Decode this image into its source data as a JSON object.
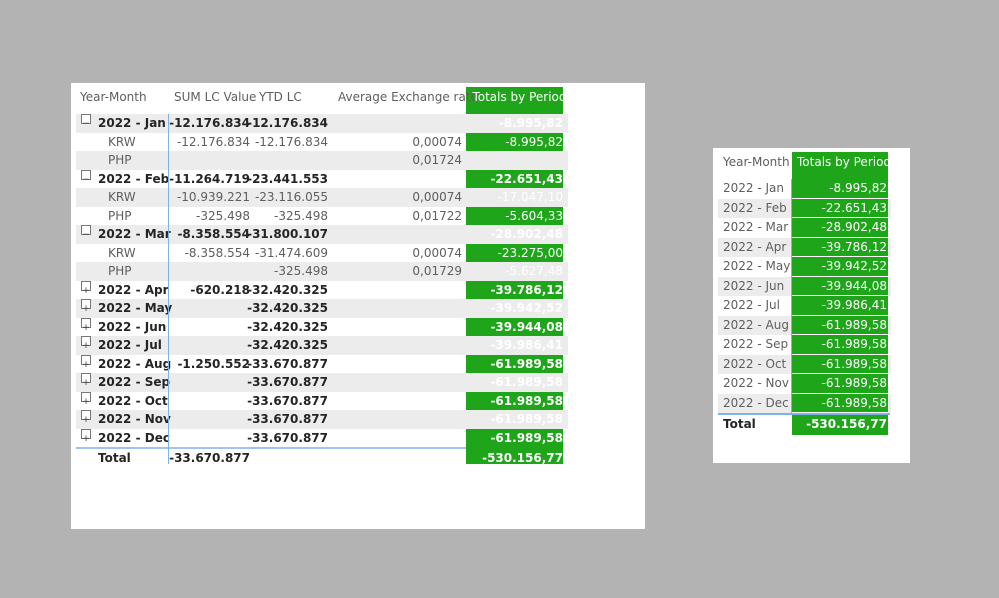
{
  "matrix": {
    "headers": {
      "year_month": "Year-Month",
      "sum_lc": "SUM LC Value",
      "ytd_lc": "YTD LC",
      "avg_rate": "Average Exchange rate",
      "totals": "Totals by Period"
    },
    "rows": [
      {
        "type": "group",
        "toggle": "⊟",
        "name": "2022 - Jan",
        "sum": "-12.176.834",
        "ytd": "-12.176.834",
        "avg": "",
        "tot": "-8.995,82"
      },
      {
        "type": "child",
        "name": "KRW",
        "sum": "-12.176.834",
        "ytd": "-12.176.834",
        "avg": "0,00074",
        "tot": "-8.995,82"
      },
      {
        "type": "child",
        "name": "PHP",
        "sum": "",
        "ytd": "",
        "avg": "0,01724",
        "tot": ""
      },
      {
        "type": "group",
        "toggle": "⊟",
        "name": "2022 - Feb",
        "sum": "-11.264.719",
        "ytd": "-23.441.553",
        "avg": "",
        "tot": "-22.651,43"
      },
      {
        "type": "child",
        "name": "KRW",
        "sum": "-10.939.221",
        "ytd": "-23.116.055",
        "avg": "0,00074",
        "tot": "-17.047,10"
      },
      {
        "type": "child",
        "name": "PHP",
        "sum": "-325.498",
        "ytd": "-325.498",
        "avg": "0,01722",
        "tot": "-5.604,33"
      },
      {
        "type": "group",
        "toggle": "⊟",
        "name": "2022 - Mar",
        "sum": "-8.358.554",
        "ytd": "-31.800.107",
        "avg": "",
        "tot": "-28.902,48"
      },
      {
        "type": "child",
        "name": "KRW",
        "sum": "-8.358.554",
        "ytd": "-31.474.609",
        "avg": "0,00074",
        "tot": "-23.275,00"
      },
      {
        "type": "child",
        "name": "PHP",
        "sum": "",
        "ytd": "-325.498",
        "avg": "0,01729",
        "tot": "-5.627,48"
      },
      {
        "type": "group",
        "toggle": "⊞",
        "name": "2022 - Apr",
        "sum": "-620.218",
        "ytd": "-32.420.325",
        "avg": "",
        "tot": "-39.786,12"
      },
      {
        "type": "group",
        "toggle": "⊞",
        "name": "2022 - May",
        "sum": "",
        "ytd": "-32.420.325",
        "avg": "",
        "tot": "-39.942,52"
      },
      {
        "type": "group",
        "toggle": "⊞",
        "name": "2022 - Jun",
        "sum": "",
        "ytd": "-32.420.325",
        "avg": "",
        "tot": "-39.944,08"
      },
      {
        "type": "group",
        "toggle": "⊞",
        "name": "2022 - Jul",
        "sum": "",
        "ytd": "-32.420.325",
        "avg": "",
        "tot": "-39.986,41"
      },
      {
        "type": "group",
        "toggle": "⊞",
        "name": "2022 - Aug",
        "sum": "-1.250.552",
        "ytd": "-33.670.877",
        "avg": "",
        "tot": "-61.989,58"
      },
      {
        "type": "group",
        "toggle": "⊞",
        "name": "2022 - Sep",
        "sum": "",
        "ytd": "-33.670.877",
        "avg": "",
        "tot": "-61.989,58"
      },
      {
        "type": "group",
        "toggle": "⊞",
        "name": "2022 - Oct",
        "sum": "",
        "ytd": "-33.670.877",
        "avg": "",
        "tot": "-61.989,58"
      },
      {
        "type": "group",
        "toggle": "⊞",
        "name": "2022 - Nov",
        "sum": "",
        "ytd": "-33.670.877",
        "avg": "",
        "tot": "-61.989,58"
      },
      {
        "type": "group",
        "toggle": "⊞",
        "name": "2022 - Dec",
        "sum": "",
        "ytd": "-33.670.877",
        "avg": "",
        "tot": "-61.989,58"
      }
    ],
    "total": {
      "name": "Total",
      "sum": "-33.670.877",
      "ytd": "",
      "avg": "",
      "tot": "-530.156,77"
    }
  },
  "summary": {
    "headers": {
      "year_month": "Year-Month",
      "totals": "Totals by Period"
    },
    "rows": [
      {
        "name": "2022 - Jan",
        "tot": "-8.995,82"
      },
      {
        "name": "2022 - Feb",
        "tot": "-22.651,43"
      },
      {
        "name": "2022 - Mar",
        "tot": "-28.902,48"
      },
      {
        "name": "2022 - Apr",
        "tot": "-39.786,12"
      },
      {
        "name": "2022 - May",
        "tot": "-39.942,52"
      },
      {
        "name": "2022 - Jun",
        "tot": "-39.944,08"
      },
      {
        "name": "2022 - Jul",
        "tot": "-39.986,41"
      },
      {
        "name": "2022 - Aug",
        "tot": "-61.989,58"
      },
      {
        "name": "2022 - Sep",
        "tot": "-61.989,58"
      },
      {
        "name": "2022 - Oct",
        "tot": "-61.989,58"
      },
      {
        "name": "2022 - Nov",
        "tot": "-61.989,58"
      },
      {
        "name": "2022 - Dec",
        "tot": "-61.989,58"
      }
    ],
    "total": {
      "name": "Total",
      "tot": "-530.156,77"
    }
  },
  "colors": {
    "highlight": "#1ea51a",
    "background": "#b3b3b3",
    "card": "#ffffff",
    "separator": "#7fb3e6"
  }
}
